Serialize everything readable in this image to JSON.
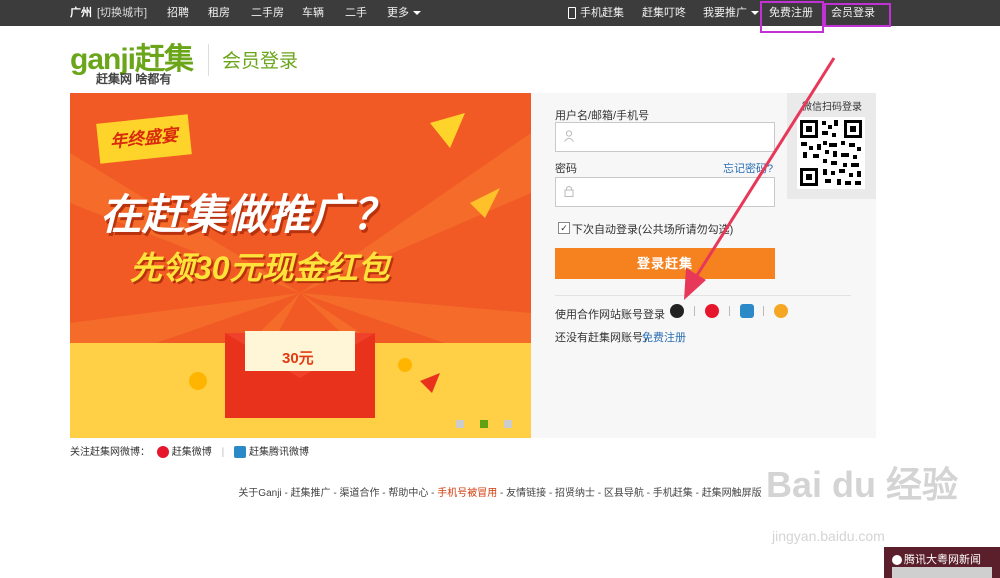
{
  "topbar": {
    "city": "广州",
    "switch_city": "[切换城市]",
    "nav": [
      "招聘",
      "租房",
      "二手房",
      "车辆",
      "二手",
      "更多"
    ],
    "mobile": "手机赶集",
    "dingdong": "赶集叮咚",
    "promote": "我要推广",
    "register": "免费注册",
    "login": "会员登录"
  },
  "header": {
    "logo_text": "ganji赶集",
    "logo_slogan": "赶集网 啥都有",
    "page_title": "会员登录"
  },
  "banner": {
    "tag": "年终盛宴",
    "headline": "在赶集做推广？",
    "subline": "先领30元现金红包",
    "amount": "30元"
  },
  "login_form": {
    "username_label": "用户名/邮箱/手机号",
    "password_label": "密码",
    "forgot_link": "忘记密码?",
    "remember_label": "下次自动登录(公共场所请勿勾选)",
    "login_button": "登录赶集",
    "social_label": "使用合作网站账号登录",
    "no_account": "还没有赶集网账号，",
    "register_link": "免费注册"
  },
  "qr": {
    "title": "微信扫码登录"
  },
  "follow": {
    "label": "关注赶集网微博：",
    "weibo": "赶集微博",
    "tencent": "赶集腾讯微博"
  },
  "footer": {
    "links": [
      "关于Ganji",
      "赶集推广",
      "渠道合作",
      "帮助中心",
      "手机号被冒用",
      "友情链接",
      "招贤纳士",
      "区县导航",
      "手机赶集",
      "赶集网触屏版"
    ]
  },
  "watermark": {
    "brand": "Bai du 经验",
    "url": "jingyan.baidu.com"
  },
  "news_popup": {
    "title": "腾讯大粤网新闻"
  },
  "colors": {
    "brand_green": "#6aa51a",
    "login_orange": "#f5811f",
    "topbar_bg": "#3c3c3c",
    "annotation_magenta": "#c231d6",
    "arrow_red": "#e8385a"
  }
}
